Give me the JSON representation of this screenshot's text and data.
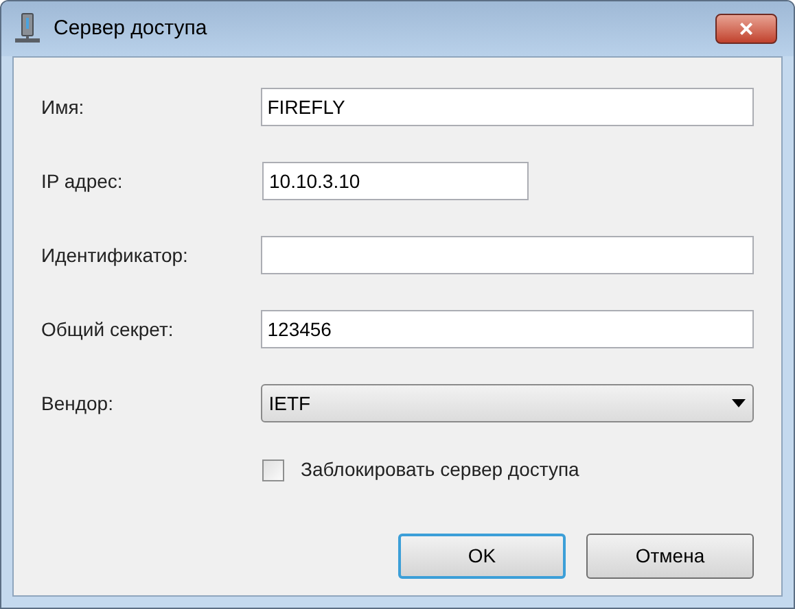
{
  "window": {
    "title": "Сервер доступа",
    "close": "×"
  },
  "fields": [
    {
      "label": "Имя:",
      "kind": "text",
      "value": "FIREFLY"
    },
    {
      "label": "IP адрес:",
      "kind": "short",
      "value": "10.10.3.10"
    },
    {
      "label": "Идентификатор:",
      "kind": "text"
    },
    {
      "label": "Общий секрет:",
      "kind": "text",
      "value": "123456"
    },
    {
      "label": "Вендор:",
      "kind": "select",
      "value": "IETF"
    }
  ],
  "checkbox": {
    "label": "Заблокировать сервер доступа",
    "checked": false
  },
  "buttons": [
    {
      "label": "OK",
      "default": true
    },
    {
      "label": "Отмена",
      "default": false
    }
  ]
}
